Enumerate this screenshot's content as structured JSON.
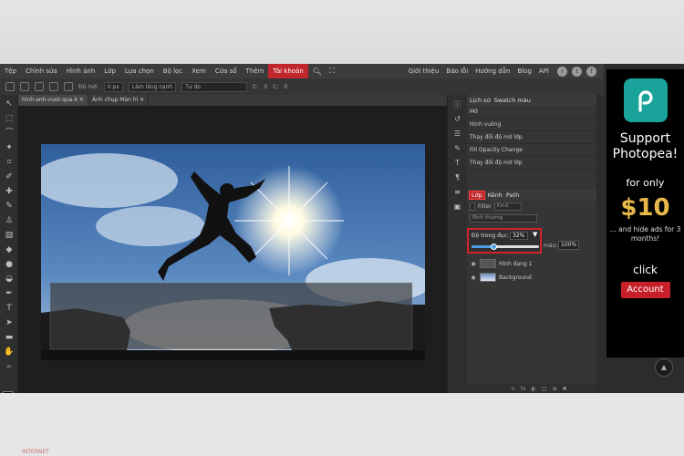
{
  "menubar": {
    "items": [
      "Tệp",
      "Chỉnh sửa",
      "Hình ảnh",
      "Lớp",
      "Lựa chọn",
      "Bộ lọc",
      "Xem",
      "Cửa sổ",
      "Thêm",
      "Tài khoản"
    ],
    "active_index": 9,
    "right_items": [
      "Giới thiệu",
      "Báo lỗi",
      "Hướng dẫn",
      "Blog",
      "API"
    ]
  },
  "optionsbar": {
    "feather_label": "Độ mờ:",
    "feather_value": "0 px",
    "antialias_label": "Làm láng cạnh",
    "style_value": "Tự do",
    "w_label": "C:",
    "w_value": "0",
    "h_label": "C:",
    "h_value": "0"
  },
  "document": {
    "tabs": [
      "hinh-anh-vuot-qua-k",
      "Ảnh chụp Màn hì"
    ]
  },
  "history": {
    "tabs": [
      "Lịch sử",
      "Swatch màu"
    ],
    "items": [
      "Mở",
      "Hình vuông",
      "Thay đổi độ mờ lớp",
      "Fill Opacity Change",
      "Thay đổi độ mờ lớp"
    ]
  },
  "layers": {
    "tabs": [
      "Lớp",
      "Kênh",
      "Path"
    ],
    "filter_label": "Filter",
    "filter_value": "Kind",
    "blend_mode": "Bình thường",
    "opacity_label": "Độ trong đục:",
    "opacity_value": "32%",
    "opacity_fraction": 0.32,
    "fill_label": "màu:",
    "fill_value": "100%",
    "items": [
      {
        "name": "Hình dạng 1"
      },
      {
        "name": "Background"
      }
    ]
  },
  "ad": {
    "support": "Support Photopea!",
    "for_only": "for only",
    "price": "$10",
    "hide_ads": "... and hide ads for 3 months!",
    "click": "click",
    "button": "Account"
  },
  "watermark": "INTERNET",
  "colors": {
    "accent_red": "#c0262c",
    "slider_blue": "#4a9fe6",
    "ad_teal": "#1aa39a",
    "ad_gold": "#e8b84a"
  }
}
